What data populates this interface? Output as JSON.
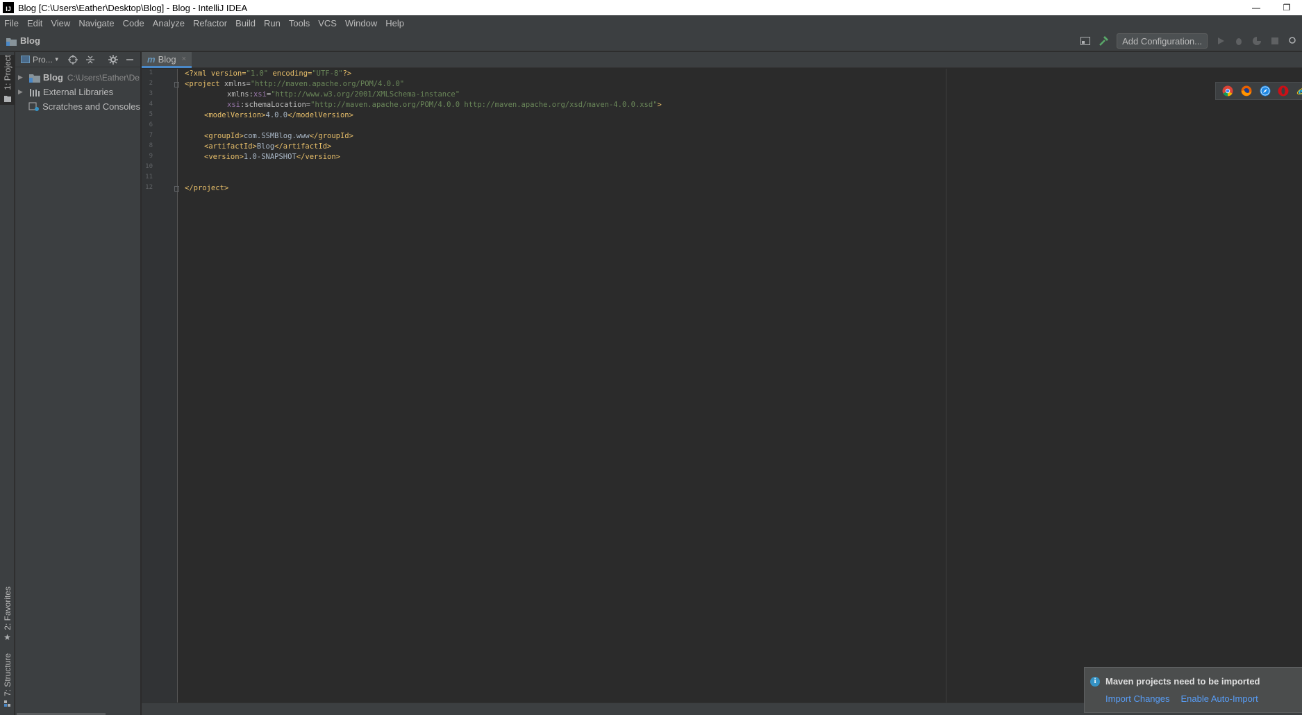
{
  "window": {
    "title": "Blog [C:\\Users\\Eather\\Desktop\\Blog] - Blog - IntelliJ IDEA",
    "logo_text": "IJ",
    "minimize": "—",
    "restore": "❐"
  },
  "menu": [
    "File",
    "Edit",
    "View",
    "Navigate",
    "Code",
    "Analyze",
    "Refactor",
    "Build",
    "Run",
    "Tools",
    "VCS",
    "Window",
    "Help"
  ],
  "navbar": {
    "breadcrumb": "Blog",
    "add_configuration": "Add Configuration..."
  },
  "left_strip": {
    "project_tab": "1: Project",
    "favorites_tab": "2: Favorites",
    "structure_tab": "7: Structure"
  },
  "project_panel": {
    "dropdown": "Pro...",
    "tree": [
      {
        "name": "Blog",
        "path": "C:\\Users\\Eather\\De"
      },
      {
        "name": "External Libraries"
      },
      {
        "name": "Scratches and Consoles"
      }
    ]
  },
  "editor": {
    "tab_prefix": "m",
    "tab_label": "Blog",
    "tab_close": "×",
    "line_numbers": [
      "1",
      "2",
      "3",
      "4",
      "5",
      "6",
      "7",
      "8",
      "9",
      "10",
      "11",
      "12"
    ]
  },
  "notification": {
    "title": "Maven projects need to be imported",
    "icon": "i",
    "import_changes": "Import Changes",
    "enable_auto_import": "Enable Auto-Import"
  },
  "icons": {
    "browsers": [
      "chrome-icon",
      "firefox-icon",
      "safari-icon",
      "opera-icon",
      "ie-icon",
      "edge-icon"
    ],
    "accent": "#4a88c7",
    "link": "#589df6"
  },
  "code": {
    "l1_a": "<?xml version=",
    "l1_b": "\"1.0\"",
    "l1_c": " encoding=",
    "l1_d": "\"UTF-8\"",
    "l1_e": "?>",
    "l2_a": "<project ",
    "l2_b": "xmlns=",
    "l2_c": "\"http://maven.apache.org/POM/4.0.0\"",
    "l3_a": "xmlns:",
    "l3_b": "xsi",
    "l3_c": "=",
    "l3_d": "\"http://www.w3.org/2001/XMLSchema-instance\"",
    "l4_a": "xsi",
    "l4_b": ":schemaLocation=",
    "l4_c": "\"http://maven.apache.org/POM/4.0.0 http://maven.apache.org/xsd/maven-4.0.0.xsd\"",
    "l4_d": ">",
    "l5_a": "<modelVersion>",
    "l5_b": "4.0.0",
    "l5_c": "</modelVersion>",
    "l7_a": "<groupId>",
    "l7_b": "com.SSMBlog.www",
    "l7_c": "</groupId>",
    "l8_a": "<artifactId>",
    "l8_b": "Blog",
    "l8_c": "</artifactId>",
    "l9_a": "<version>",
    "l9_b": "1.0-SNAPSHOT",
    "l9_c": "</version>",
    "l12_a": "</project>"
  }
}
